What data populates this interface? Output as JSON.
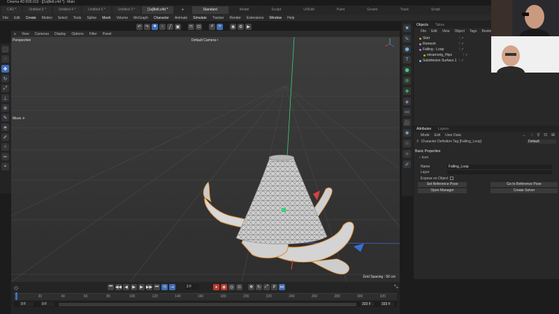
{
  "titlebar": {
    "title": "Cinema 4D R26.013 - [[1a]8elt.c4d *] - Main"
  },
  "doc_tabs": [
    {
      "label": "C4D *",
      "active": false
    },
    {
      "label": "Untitled 5 *",
      "active": false
    },
    {
      "label": "Untitled 4 *",
      "active": false
    },
    {
      "label": "Untitled 6 *",
      "active": false
    },
    {
      "label": "Untitled 3 *",
      "active": false
    },
    {
      "label": "[1a]8elt.c4d *",
      "active": true
    }
  ],
  "layout_tabs": [
    {
      "label": "Standard",
      "active": true
    },
    {
      "label": "Model",
      "active": false
    },
    {
      "label": "Sculpt",
      "active": false
    },
    {
      "label": "UVEdit",
      "active": false
    },
    {
      "label": "Paint",
      "active": false
    },
    {
      "label": "Groom",
      "active": false
    },
    {
      "label": "Track",
      "active": false
    },
    {
      "label": "Script",
      "active": false
    }
  ],
  "main_menu": [
    "File",
    "Edit",
    "Create",
    "Modes",
    "Select",
    "Tools",
    "Spline",
    "Mesh",
    "Volume",
    "MoGraph",
    "Character",
    "Animate",
    "Simulate",
    "Tracker",
    "Render",
    "Extensions",
    "Window",
    "Help"
  ],
  "viewport": {
    "menu": [
      "View",
      "Cameras",
      "Display",
      "Options",
      "Filter",
      "Panel"
    ],
    "name": "Perspective",
    "camera": "Default Camera •",
    "hint": "Move ✛",
    "grid_spacing": "Grid Spacing : 50 cm"
  },
  "timeline": {
    "frame_field": "2 F",
    "ticks": [
      "0",
      "20",
      "40",
      "60",
      "80",
      "100",
      "120",
      "140",
      "160",
      "180",
      "200",
      "220",
      "240",
      "260",
      "280",
      "300",
      "320"
    ],
    "start": "0 F",
    "start2": "0 F",
    "end": "333 F",
    "end2": "333 F"
  },
  "objects_panel": {
    "tabs": [
      {
        "label": "Objects",
        "active": true
      },
      {
        "label": "Takes",
        "active": false
      }
    ],
    "menu": [
      "File",
      "Edit",
      "View",
      "Object",
      "Tags",
      "Bookmarks"
    ],
    "rows": [
      {
        "name": "Skirt",
        "color": "#c9a227"
      },
      {
        "name": "Remesh",
        "color": "#c07de0"
      },
      {
        "name": "Falling - Loop",
        "color": "#c07de0"
      },
      {
        "name": "mixamorig_Hips",
        "color": "#c9a227"
      },
      {
        "name": "Subdivision Surface.1",
        "color": "#63c9ea"
      }
    ]
  },
  "attributes_panel": {
    "tabs": [
      {
        "label": "Attributes",
        "active": true
      },
      {
        "label": "Layers",
        "active": false
      }
    ],
    "menu": [
      "Mode",
      "Edit",
      "User Data"
    ],
    "object_title": "Character Definition Tag [Falling_Loop]",
    "preset": "Default",
    "section": "Basic Properties",
    "icon_label": "Icon",
    "name_label": "Name",
    "name_value": "Falling_Loop",
    "layer_label": "Layer",
    "expose_label": "Expose on Object",
    "buttons": {
      "set_reference": "Set Reference Pose",
      "goto_reference": "Go to Reference Pose",
      "open_manager": "Open Manager",
      "create_solver": "Create Solver"
    }
  },
  "colors": {
    "accent": "#3f6db5",
    "selection_orange": "#e08a2a",
    "axis_green": "#3ad17a"
  }
}
